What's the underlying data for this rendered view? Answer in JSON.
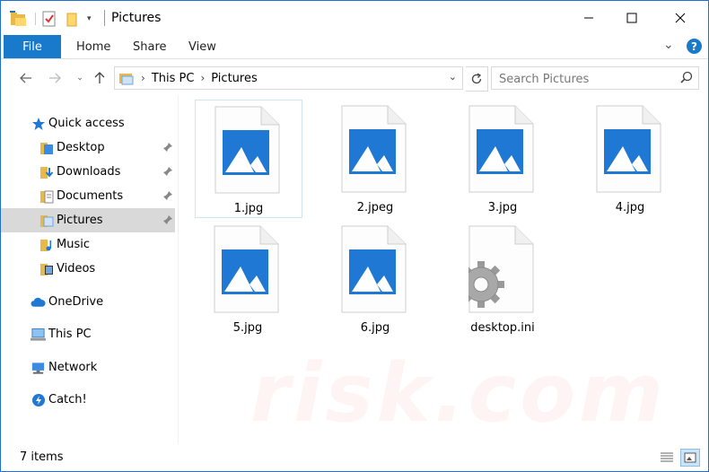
{
  "window": {
    "title": "Pictures"
  },
  "ribbon": {
    "file_tab": "File",
    "tabs": [
      "Home",
      "Share",
      "View"
    ],
    "help": "?"
  },
  "address": {
    "crumbs": [
      "This PC",
      "Pictures"
    ]
  },
  "search": {
    "placeholder": "Search Pictures"
  },
  "nav": {
    "items": [
      {
        "label": "Quick access",
        "icon": "star-icon"
      },
      {
        "label": "Desktop",
        "icon": "desktop-folder-icon",
        "pinned": true
      },
      {
        "label": "Downloads",
        "icon": "downloads-folder-icon",
        "pinned": true
      },
      {
        "label": "Documents",
        "icon": "documents-folder-icon",
        "pinned": true
      },
      {
        "label": "Pictures",
        "icon": "pictures-folder-icon",
        "pinned": true,
        "selected": true
      },
      {
        "label": "Music",
        "icon": "music-folder-icon"
      },
      {
        "label": "Videos",
        "icon": "videos-folder-icon"
      },
      {
        "label": "OneDrive",
        "icon": "cloud-icon"
      },
      {
        "label": "This PC",
        "icon": "computer-icon"
      },
      {
        "label": "Network",
        "icon": "network-icon"
      },
      {
        "label": "Catch!",
        "icon": "catch-app-icon"
      }
    ]
  },
  "files": [
    {
      "name": "1.jpg",
      "type": "image"
    },
    {
      "name": "2.jpeg",
      "type": "image"
    },
    {
      "name": "3.jpg",
      "type": "image"
    },
    {
      "name": "4.jpg",
      "type": "image"
    },
    {
      "name": "5.jpg",
      "type": "image"
    },
    {
      "name": "6.jpg",
      "type": "image"
    },
    {
      "name": "desktop.ini",
      "type": "settings"
    }
  ],
  "status": {
    "item_count": "7 items"
  },
  "colors": {
    "accent": "#1979ca",
    "selected_nav": "#d9d9d9",
    "image_icon": "#1e78d4"
  }
}
